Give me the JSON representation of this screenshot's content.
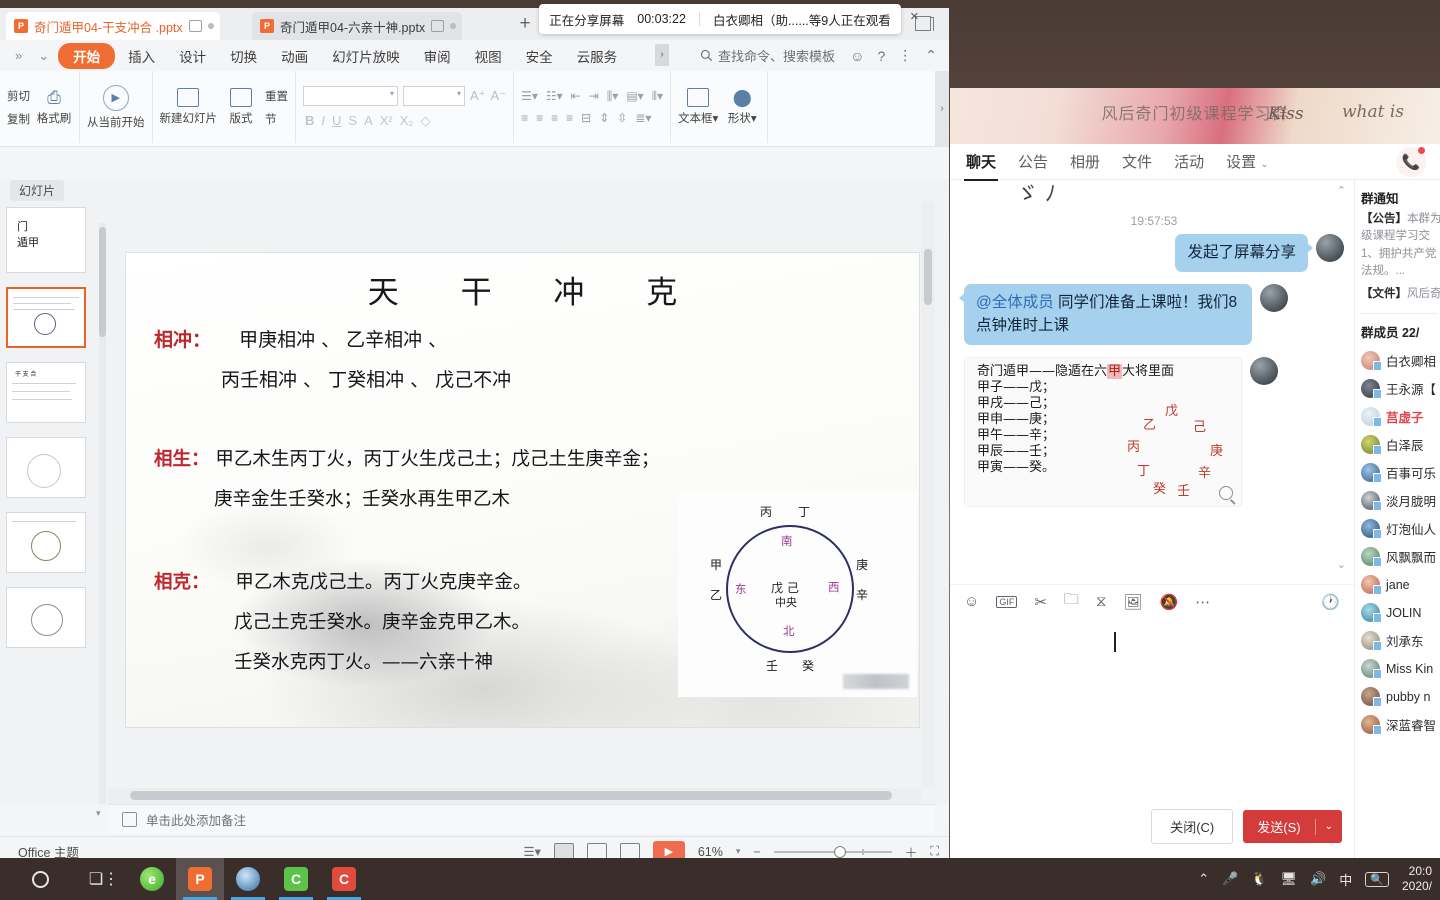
{
  "share_bar": {
    "status": "正在分享屏幕",
    "timer": "00:03:22",
    "viewers": "白衣卿相（助......等9人正在观看",
    "close_icon": "×"
  },
  "ppt": {
    "tabs": [
      {
        "label": "奇门遁甲04-干支冲合 .pptx",
        "active": true
      },
      {
        "label": "奇门遁甲04-六亲十神.pptx",
        "active": false
      }
    ],
    "new_tab": "+",
    "ribbon_tabs": [
      "开始",
      "插入",
      "设计",
      "切换",
      "动画",
      "幻灯片放映",
      "审阅",
      "视图",
      "安全",
      "云服务"
    ],
    "ribbon_selected": "开始",
    "search_placeholder": "查找命令、搜索模板",
    "ribbon_groups": {
      "clipboard": {
        "cut": "剪切",
        "copy": "复制",
        "format_painter": "格式刷"
      },
      "slides": {
        "from_current": "从当前开始",
        "new_slide": "新建幻灯片",
        "layout": "版式",
        "reset": "重置",
        "section": "节"
      }
    },
    "thumbs_label": "幻灯片",
    "notes_placeholder": "单击此处添加备注",
    "theme": "Office 主题",
    "zoom": "61%",
    "slide": {
      "title": "天 干 冲 克",
      "rows": [
        {
          "label": "相冲：",
          "lines": [
            "甲庚相冲 、 乙辛相冲 、",
            "丙壬相冲 、 丁癸相冲 、 戊己不冲"
          ]
        },
        {
          "label": "相生：",
          "lines": [
            "甲乙木生丙丁火，丙丁火生戊己土；戊己土生庚辛金；",
            "庚辛金生壬癸水；壬癸水再生甲乙木"
          ]
        },
        {
          "label": "相克：",
          "lines": [
            "甲乙木克戊己土。丙丁火克庚辛金。",
            "戊己土克壬癸水。庚辛金克甲乙木。",
            "壬癸水克丙丁火。——六亲十神"
          ]
        }
      ],
      "diagram": {
        "outer": {
          "top_left": "丙",
          "top_right": "丁",
          "left_upper": "甲",
          "left_lower": "乙",
          "right_upper": "庚",
          "right_lower": "辛",
          "bottom_left": "壬",
          "bottom_right": "癸"
        },
        "directions": {
          "south": "南",
          "east": "东",
          "west": "西",
          "north": "北"
        },
        "center": {
          "chars": "戊 己",
          "label": "中央"
        }
      }
    }
  },
  "qq": {
    "group_title": "风后奇门初级课程学习群",
    "header_art": {
      "kiss": "Kiss",
      "what_is": "what is"
    },
    "tabs": [
      "聊天",
      "公告",
      "相册",
      "文件",
      "活动",
      "设置"
    ],
    "tab_active": "聊天",
    "messages": [
      {
        "time": "19:57:53"
      },
      {
        "type": "text",
        "side": "right",
        "text": "发起了屏幕分享"
      },
      {
        "type": "text",
        "side": "left",
        "mention": "@全体成员",
        "text": " 同学们准备上课啦！我们8点钟准时上课"
      },
      {
        "type": "image",
        "side": "left",
        "lines": [
          "奇门遁甲——隐遁在六甲大将里面",
          "甲子——戊；",
          "甲戌——己；",
          "甲申——庚；",
          "甲午——辛；",
          "甲辰——壬；",
          "甲寅——癸。"
        ],
        "highlight": "甲",
        "red_chars": [
          "戊",
          "乙",
          "己",
          "丙",
          "庚",
          "丁",
          "辛",
          "癸",
          "壬"
        ]
      }
    ],
    "toolbar_icons": [
      "emoji-icon",
      "gif-icon",
      "scissors-icon",
      "folder-icon",
      "shake-icon",
      "image-icon",
      "bell-off-icon",
      "more-icon"
    ],
    "toolbar_right_icon": "history-icon",
    "gif_label": "GIF",
    "buttons": {
      "close": "关闭(C)",
      "send": "发送(S)",
      "send_caret": "⌄"
    },
    "sidebar": {
      "notice_title": "群通知",
      "notice_lines": [
        "【公告】本群为",
        "级课程学习交",
        "1、拥护共产党",
        "法规。..."
      ],
      "file_line": "【文件】风后奇",
      "members_title": "群成员 22/",
      "members": [
        "白衣卿相",
        "王永源【",
        "莒虚子",
        "白泽辰",
        "百事可乐",
        "淡月胧明",
        "灯泡仙人",
        "风飘飘而",
        "jane",
        "JOLIN",
        "刘承东",
        "Miss Kin",
        "pubby n",
        "深蓝睿智"
      ],
      "admin_member": "莒虚子"
    }
  },
  "taskbar": {
    "icons": [
      "cortana-circle-icon",
      "task-view-icon",
      "edge-icon",
      "powerpoint-icon",
      "ie-icon",
      "wechat-icon",
      "qq-pc-icon"
    ],
    "tray": [
      "chevron-up-icon",
      "microphone-icon",
      "qq-penguin-icon",
      "network-icon",
      "volume-icon",
      "ime-cn-icon",
      "search-box-icon"
    ],
    "ime_label": "中",
    "clock_time": "20:0",
    "clock_date": "2020/"
  },
  "colors": {
    "accent_orange": "#ef6c33",
    "send_red": "#d43c3c",
    "bubble_blue": "#a5d1ee",
    "slide_label_red": "#c0272d",
    "diagram_purple": "#9b3a93",
    "taskbar_bg": "#3a2e2b"
  }
}
